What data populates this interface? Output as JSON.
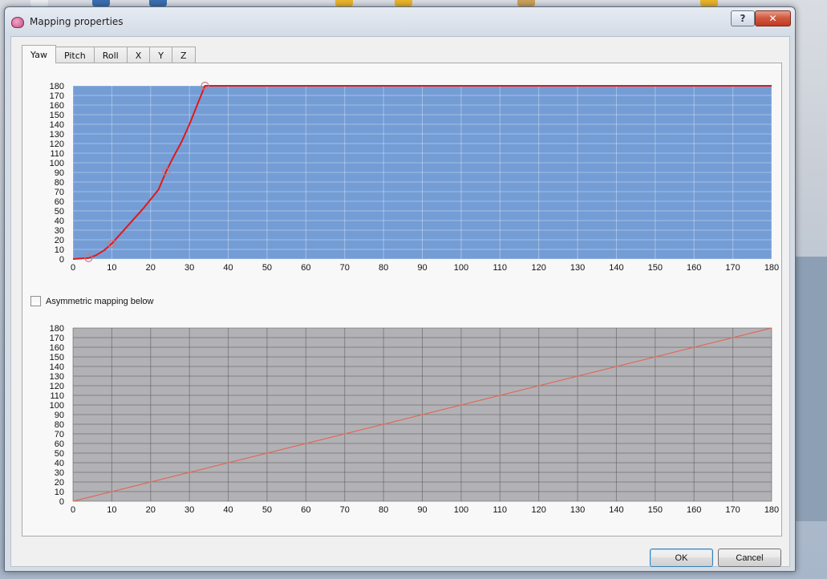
{
  "window": {
    "title": "Mapping properties",
    "help_label": "?",
    "close_label": "✕"
  },
  "tabs": [
    {
      "label": "Yaw",
      "active": true
    },
    {
      "label": "Pitch",
      "active": false
    },
    {
      "label": "Roll",
      "active": false
    },
    {
      "label": "X",
      "active": false
    },
    {
      "label": "Y",
      "active": false
    },
    {
      "label": "Z",
      "active": false
    }
  ],
  "asymmetric": {
    "label": "Asymmetric mapping below",
    "checked": false
  },
  "buttons": {
    "ok": "OK",
    "cancel": "Cancel"
  },
  "icons": {
    "app": "app-icon",
    "help": "help-icon",
    "close": "close-icon"
  },
  "colors": {
    "top_plot_bg": "#749dd6",
    "bottom_plot_bg": "#b2b2b6",
    "curve": "#e01919",
    "bottom_line": "#e06a5a"
  },
  "chart_data": [
    {
      "type": "line",
      "title": "",
      "xlabel": "",
      "ylabel": "",
      "xlim": [
        0,
        180
      ],
      "ylim": [
        0,
        180
      ],
      "x_ticks": [
        0,
        10,
        20,
        30,
        40,
        50,
        60,
        70,
        80,
        90,
        100,
        110,
        120,
        130,
        140,
        150,
        160,
        170,
        180
      ],
      "y_ticks": [
        0,
        10,
        20,
        30,
        40,
        50,
        60,
        70,
        80,
        90,
        100,
        110,
        120,
        130,
        140,
        150,
        160,
        170,
        180
      ],
      "grid": true,
      "series": [
        {
          "x": [
            0,
            4,
            6,
            8,
            10,
            14,
            18,
            22,
            24,
            26,
            28,
            30,
            32,
            34,
            180
          ],
          "y": [
            0,
            1,
            4,
            9,
            16,
            34,
            52,
            72,
            91,
            107,
            122,
            140,
            160,
            180,
            180
          ]
        }
      ],
      "control_points": [
        {
          "x": 4,
          "y": 1
        },
        {
          "x": 10,
          "y": 16
        },
        {
          "x": 24,
          "y": 91
        },
        {
          "x": 34,
          "y": 180
        }
      ]
    },
    {
      "type": "line",
      "title": "",
      "xlabel": "",
      "ylabel": "",
      "xlim": [
        0,
        180
      ],
      "ylim": [
        0,
        180
      ],
      "x_ticks": [
        0,
        10,
        20,
        30,
        40,
        50,
        60,
        70,
        80,
        90,
        100,
        110,
        120,
        130,
        140,
        150,
        160,
        170,
        180
      ],
      "y_ticks": [
        0,
        10,
        20,
        30,
        40,
        50,
        60,
        70,
        80,
        90,
        100,
        110,
        120,
        130,
        140,
        150,
        160,
        170,
        180
      ],
      "grid": true,
      "series": [
        {
          "x": [
            0,
            180
          ],
          "y": [
            0,
            180
          ]
        }
      ]
    }
  ]
}
